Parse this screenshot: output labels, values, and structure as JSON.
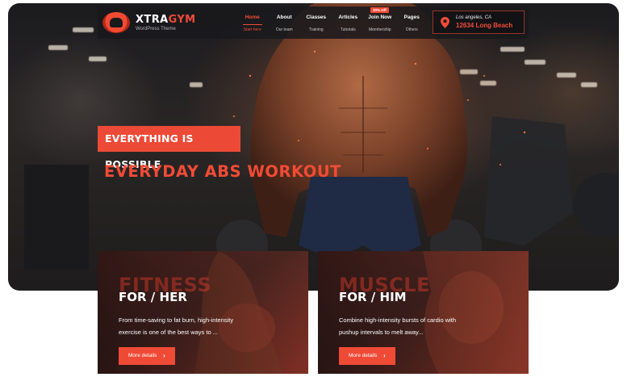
{
  "brand": {
    "name_part1": "XTRA",
    "name_part2": "GYM",
    "tagline": "WordPress Theme"
  },
  "nav": [
    {
      "label": "Home",
      "sub": "Start here",
      "active": true
    },
    {
      "label": "About",
      "sub": "Our team"
    },
    {
      "label": "Classes",
      "sub": "Training"
    },
    {
      "label": "Articles",
      "sub": "Tutorials"
    },
    {
      "label": "Join Now",
      "sub": "Membership",
      "badge": "30% Off"
    },
    {
      "label": "Pages",
      "sub": "Others"
    }
  ],
  "location": {
    "city": "Los angeles, CA",
    "address": "12634 Long Beach",
    "icon": "map-pin-icon"
  },
  "hero": {
    "tag": "EVERYTHING IS POSSIBLE",
    "title": "EVERYDAY ABS WORKOUT"
  },
  "cards": [
    {
      "ghost": "FITNESS",
      "prefix": "FOR",
      "slash": "/",
      "target": "HER",
      "desc": "From time-saving to fat burn, high-intensity exercise is one of the best ways to ...",
      "button": "More details",
      "button_icon": "chevron-right-icon"
    },
    {
      "ghost": "MUSCLE",
      "prefix": "FOR",
      "slash": "/",
      "target": "HIM",
      "desc": "Combine high-intensity bursts of cardio with pushup intervals to melt away...",
      "button": "More details",
      "button_icon": "chevron-right-icon"
    }
  ],
  "colors": {
    "accent": "#f24b36",
    "header_bg": "#19191c"
  }
}
